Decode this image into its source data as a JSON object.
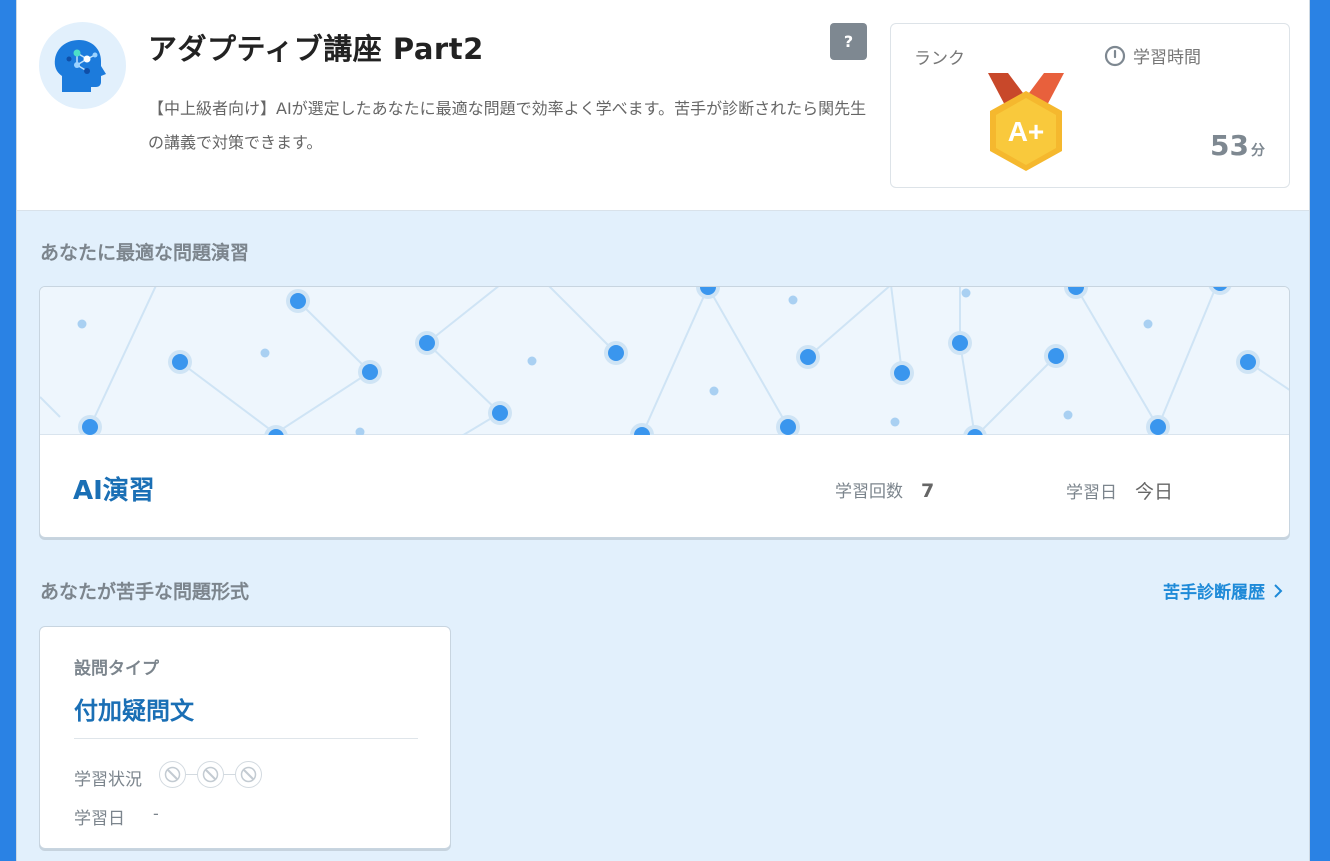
{
  "course": {
    "title": "アダプティブ講座 Part2",
    "description": "【中上級者向け】AIが選定したあなたに最適な問題で効率よく学べます。苦手が診断されたら関先生の講義で対策できます。",
    "help_label": "?"
  },
  "rank": {
    "label": "ランク",
    "grade": "A+",
    "study_time_label": "学習時間",
    "study_time_value": "53",
    "study_time_unit": "分"
  },
  "ai_section": {
    "title": "あなたに最適な問題演習",
    "card": {
      "name": "AI演習",
      "count_label": "学習回数",
      "count_value": "7",
      "date_label": "学習日",
      "date_value": "今日"
    }
  },
  "weak_section": {
    "title": "あなたが苦手な問題形式",
    "history_link": "苦手診断履歴",
    "cards": [
      {
        "type_label": "設問タイプ",
        "type_value": "付加疑問文",
        "status_label": "学習状況",
        "date_label": "学習日",
        "date_value": "-"
      }
    ]
  },
  "icons": {
    "course": "brain-network-icon",
    "help": "question-icon",
    "rank": "medal-icon",
    "time": "clock-icon",
    "chevron": "chevron-right-icon",
    "status": "not-started-icon"
  },
  "colors": {
    "accent": "#1a6fb5",
    "link": "#1e8ad8",
    "page_bg": "#e2f0fc",
    "medal_gold": "#f9c93c",
    "ribbon": "#e8603c"
  }
}
